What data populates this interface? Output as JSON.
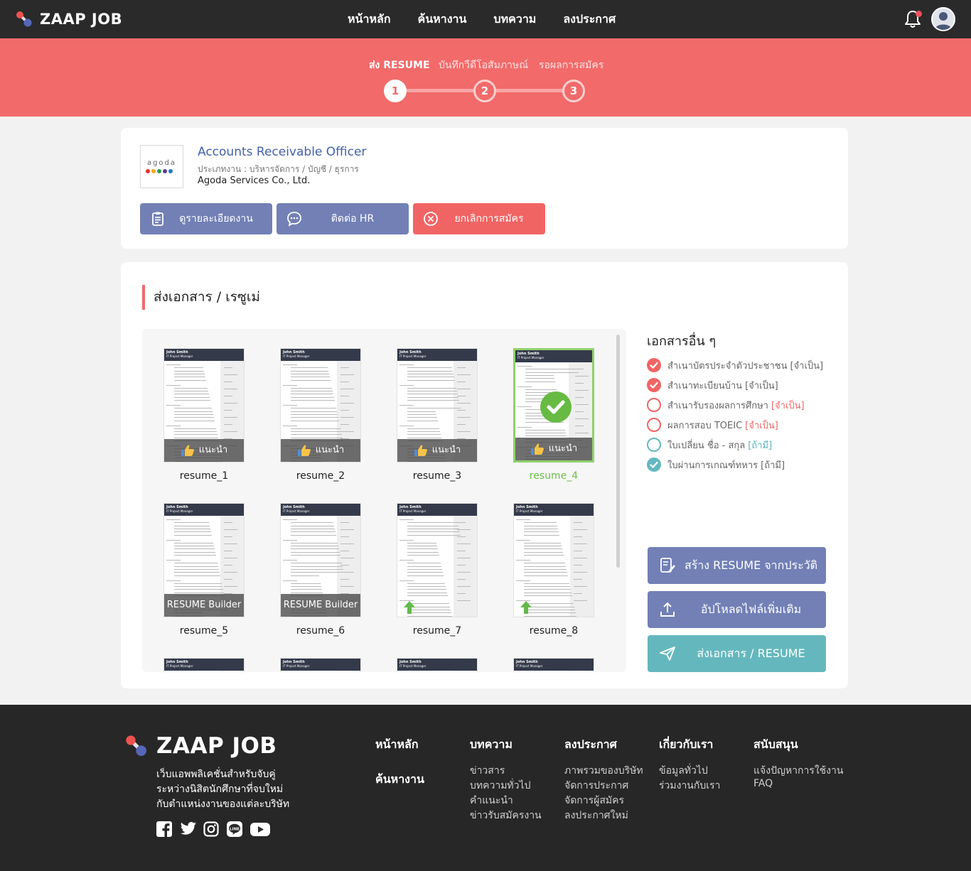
{
  "header": {
    "brand": "ZAAP JOB",
    "nav": [
      "หน้าหลัก",
      "ค้นหางาน",
      "บทความ",
      "ลงประกาศ"
    ]
  },
  "progress": {
    "steps": [
      {
        "label": "ส่ง RESUME",
        "number": "1",
        "status": "active"
      },
      {
        "label": "บันทึกวีดีโอสัมภาษณ์",
        "number": "2",
        "status": "todo"
      },
      {
        "label": "รอผลการสมัคร",
        "number": "3",
        "status": "todo"
      }
    ]
  },
  "job": {
    "logo_text": "agoda",
    "logo_dot_colors": [
      "#e0332a",
      "#f4a91d",
      "#2f9b43",
      "#5c3b95",
      "#1a7bc0"
    ],
    "title": "Accounts Receivable Officer",
    "category": "ประเภทงาน : บริหารจัดการ / บัญชี / ธุรการ",
    "company": "Agoda Services Co., Ltd.",
    "buttons": {
      "details": "ดูรายละเอียดงาน",
      "contact": "ติดต่อ HR",
      "cancel": "ยกเลิกการสมัคร"
    }
  },
  "documents": {
    "section_title": "ส่งเอกสาร / เรซูเม่",
    "resumes": [
      {
        "name": "resume_1",
        "overlay": "แนะนำ",
        "kind": "recommend",
        "selected": false
      },
      {
        "name": "resume_2",
        "overlay": "แนะนำ",
        "kind": "recommend",
        "selected": false
      },
      {
        "name": "resume_3",
        "overlay": "แนะนำ",
        "kind": "recommend",
        "selected": false
      },
      {
        "name": "resume_4",
        "overlay": "แนะนำ",
        "kind": "recommend",
        "selected": true
      },
      {
        "name": "resume_5",
        "overlay": "RESUME Builder",
        "kind": "builder",
        "selected": false
      },
      {
        "name": "resume_6",
        "overlay": "RESUME Builder",
        "kind": "builder",
        "selected": false
      },
      {
        "name": "resume_7",
        "overlay": "",
        "kind": "upload",
        "selected": false
      },
      {
        "name": "resume_8",
        "overlay": "",
        "kind": "upload",
        "selected": false
      }
    ],
    "thumb_name": "John Smith",
    "thumb_role": "IT Project Manager",
    "other_title": "เอกสารอื่น ๆ",
    "other_docs": [
      {
        "label": "สำเนาบัตรประจำตัวประชาชน",
        "req": "[จำเป็น]",
        "state": "done-red",
        "req_style": "grey"
      },
      {
        "label": "สำเนาทะเบียนบ้าน",
        "req": "[จำเป็น]",
        "state": "done-red",
        "req_style": "grey"
      },
      {
        "label": "สำเนารับรองผลการศึกษา",
        "req": "[จำเป็น]",
        "state": "todo-red",
        "req_style": "red"
      },
      {
        "label": "ผลการสอบ TOEIC",
        "req": "[จำเป็น]",
        "state": "todo-red",
        "req_style": "red"
      },
      {
        "label": "ใบเปลี่ยน ชื่อ - สกุล",
        "req": "[ถ้ามี]",
        "state": "todo-teal",
        "req_style": "teal"
      },
      {
        "label": "ใบผ่านการเกณฑ์ทหาร",
        "req": "[ถ้ามี]",
        "state": "done-teal",
        "req_style": "grey"
      }
    ],
    "create_button": "สร้าง RESUME จากประวัติ",
    "upload_button": "อัปโหลดไฟล์เพิ่มเติม",
    "send_button": "ส่งเอกสาร / RESUME"
  },
  "footer": {
    "brand": "ZAAP JOB",
    "tagline": [
      "เว็บแอพพลิเคชั่นสำหรับจับคู่",
      "ระหว่างนิสิตนักศึกษาที่จบใหม่",
      "กับตำแหน่งงานของแต่ละบริษัท"
    ],
    "social": [
      "facebook-icon",
      "twitter-icon",
      "instagram-icon",
      "line-icon",
      "youtube-icon"
    ],
    "col_home": "หน้าหลัก",
    "col_search": "ค้นหางาน",
    "columns": [
      {
        "title": "บทความ",
        "links": [
          "ข่าวสาร",
          "บทความทั่วไป",
          "คำแนะนำ",
          "ข่าวรับสมัครงาน"
        ]
      },
      {
        "title": "ลงประกาศ",
        "links": [
          "ภาพรวมของบริษัท",
          "จัดการประกาศ",
          "จัดการผู้สมัคร",
          "ลงประกาศใหม่"
        ]
      },
      {
        "title": "เกี่ยวกับเรา",
        "links": [
          "ข้อมูลทั่วไป",
          "ร่วมงานกับเรา"
        ]
      },
      {
        "title": "สนับสนุน",
        "links": [
          "แจ้งปัญหาการใช้งาน",
          "FAQ"
        ]
      }
    ]
  },
  "colors": {
    "accent_red": "#f26a6a",
    "button_blue": "#7280b6",
    "button_teal": "#64b8bd",
    "link_blue": "#4161a8",
    "selected_green": "#6cc04a"
  }
}
